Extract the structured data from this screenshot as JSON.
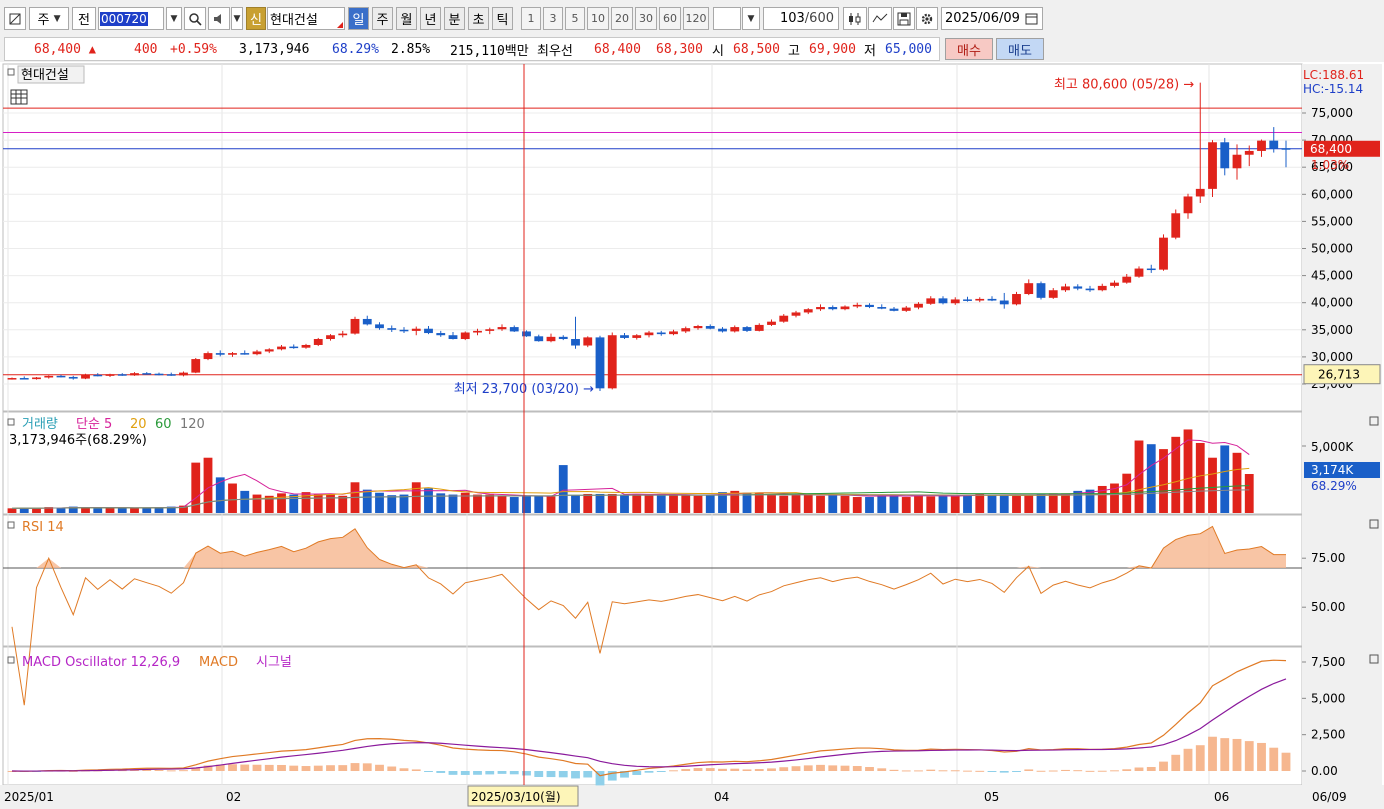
{
  "toolbar": {
    "code": "000720",
    "market": "주",
    "period_prefix": "전",
    "new_badge": "신",
    "stock_name": "현대건설",
    "period_tabs": [
      "일",
      "주",
      "월",
      "년",
      "분",
      "초",
      "틱"
    ],
    "active_period": "일",
    "intervals": [
      "1",
      "3",
      "5",
      "10",
      "20",
      "30",
      "60",
      "120"
    ],
    "count": "103",
    "count_total": "/600",
    "date": "2025/06/09"
  },
  "quote": {
    "price": "68,400",
    "up_arrow": "▲",
    "change": "400",
    "change_pct": "+0.59%",
    "volume": "3,173,946",
    "volume_ratio": "68.29%",
    "turnover_pct": "2.85%",
    "amount": "215,110백만",
    "best_label": "최우선",
    "ask": "68,400",
    "bid": "68,300",
    "open_label": "시",
    "open": "68,500",
    "high_label": "고",
    "high": "69,900",
    "low_label": "저",
    "low": "65,000",
    "buy_label": "매수",
    "sell_label": "매도"
  },
  "price_pane": {
    "stock_label": "현대건설",
    "lc": "LC:188.61",
    "hc": "HC:-15.14",
    "high_annotation": "최고 80,600 (05/28) →",
    "low_annotation": "최저 23,700 (03/20) →",
    "axis_ticks": [
      "75,000",
      "70,000",
      "65,000",
      "60,000",
      "55,000",
      "50,000",
      "45,000",
      "40,000",
      "35,000",
      "30,000",
      "25,000"
    ],
    "current_price_tag": "68,400",
    "current_pct": "1.03%",
    "crosshair_price_tag": "26,713",
    "colors": {
      "up": "#e0231b",
      "down": "#1a5fc8"
    }
  },
  "volume_pane": {
    "title": "거래량",
    "ma_label": "단순 5",
    "ma_periods": [
      "20",
      "60",
      "120"
    ],
    "info": "3,173,946주(68.29%)",
    "axis_tick": "5,000K",
    "tag": "3,174K",
    "tag_pct": "68.29%"
  },
  "rsi_pane": {
    "title": "RSI 14",
    "axis_ticks": [
      "75.00",
      "50.00"
    ]
  },
  "macd_pane": {
    "title": "MACD Oscillator 12,26,9",
    "macd_label": "MACD",
    "signal_label": "시그널",
    "axis_ticks": [
      "7,500",
      "5,000",
      "2,500",
      "0.00"
    ]
  },
  "x_axis": {
    "labels": [
      "2025/01",
      "02",
      "04",
      "05",
      "06",
      "06/09"
    ],
    "crosshair_date": "2025/03/10(월)"
  },
  "chart_data": {
    "type": "candlestick",
    "y_range": [
      22000,
      82000
    ],
    "candles": [
      [
        26000,
        26200,
        25800,
        26100
      ],
      [
        26100,
        26400,
        25900,
        25900
      ],
      [
        25900,
        26300,
        25800,
        26200
      ],
      [
        26200,
        26600,
        26000,
        26500
      ],
      [
        26500,
        26700,
        26200,
        26300
      ],
      [
        26300,
        26500,
        25800,
        26000
      ],
      [
        26000,
        26900,
        25900,
        26700
      ],
      [
        26700,
        27000,
        26400,
        26500
      ],
      [
        26500,
        26900,
        26300,
        26800
      ],
      [
        26800,
        27000,
        26500,
        26600
      ],
      [
        26600,
        27200,
        26500,
        27000
      ],
      [
        27000,
        27200,
        26700,
        26900
      ],
      [
        26900,
        27100,
        26600,
        26800
      ],
      [
        26800,
        27100,
        26500,
        26600
      ],
      [
        26600,
        27300,
        26400,
        27100
      ],
      [
        27100,
        29800,
        27000,
        29600
      ],
      [
        29600,
        31000,
        29400,
        30700
      ],
      [
        30700,
        31200,
        30100,
        30400
      ],
      [
        30400,
        30900,
        30000,
        30700
      ],
      [
        30700,
        31200,
        30400,
        30500
      ],
      [
        30500,
        31300,
        30300,
        31000
      ],
      [
        31000,
        31600,
        30700,
        31400
      ],
      [
        31400,
        32200,
        31200,
        31900
      ],
      [
        31900,
        32300,
        31500,
        31700
      ],
      [
        31700,
        32400,
        31500,
        32200
      ],
      [
        32200,
        33500,
        32000,
        33300
      ],
      [
        33300,
        34200,
        33000,
        34000
      ],
      [
        34000,
        34800,
        33600,
        34300
      ],
      [
        34300,
        37400,
        34100,
        37000
      ],
      [
        37000,
        37600,
        35800,
        36000
      ],
      [
        36000,
        36400,
        35000,
        35300
      ],
      [
        35300,
        35800,
        34600,
        35000
      ],
      [
        35000,
        35500,
        34400,
        34800
      ],
      [
        34800,
        35600,
        34000,
        35200
      ],
      [
        35200,
        35700,
        34200,
        34400
      ],
      [
        34400,
        34800,
        33700,
        34000
      ],
      [
        34000,
        34600,
        33200,
        33300
      ],
      [
        33300,
        34700,
        33100,
        34500
      ],
      [
        34500,
        35200,
        34000,
        34800
      ],
      [
        34800,
        35400,
        34200,
        35100
      ],
      [
        35100,
        36000,
        34800,
        35500
      ],
      [
        35500,
        35800,
        34600,
        34700
      ],
      [
        34700,
        34900,
        33700,
        33800
      ],
      [
        33800,
        34100,
        32800,
        32900
      ],
      [
        32900,
        34300,
        32700,
        33700
      ],
      [
        33700,
        34000,
        33100,
        33300
      ],
      [
        33300,
        37400,
        31500,
        32100
      ],
      [
        32100,
        33800,
        31800,
        33600
      ],
      [
        33600,
        33900,
        23700,
        24200
      ],
      [
        24200,
        34500,
        24000,
        34000
      ],
      [
        34000,
        34400,
        33300,
        33500
      ],
      [
        33500,
        34200,
        33200,
        34000
      ],
      [
        34000,
        34800,
        33600,
        34500
      ],
      [
        34500,
        34800,
        33900,
        34200
      ],
      [
        34200,
        35000,
        34000,
        34700
      ],
      [
        34700,
        35600,
        34400,
        35300
      ],
      [
        35300,
        35900,
        35000,
        35700
      ],
      [
        35700,
        36000,
        35100,
        35200
      ],
      [
        35200,
        35500,
        34500,
        34700
      ],
      [
        34700,
        35800,
        34500,
        35500
      ],
      [
        35500,
        35700,
        34600,
        34800
      ],
      [
        34800,
        36200,
        34700,
        35900
      ],
      [
        35900,
        36900,
        35700,
        36500
      ],
      [
        36500,
        37900,
        36300,
        37600
      ],
      [
        37600,
        38500,
        37300,
        38200
      ],
      [
        38200,
        39000,
        37900,
        38800
      ],
      [
        38800,
        39700,
        38500,
        39200
      ],
      [
        39200,
        39500,
        38600,
        38800
      ],
      [
        38800,
        39500,
        38600,
        39300
      ],
      [
        39300,
        40000,
        39000,
        39600
      ],
      [
        39600,
        39900,
        39000,
        39200
      ],
      [
        39200,
        39700,
        38800,
        38900
      ],
      [
        38900,
        39200,
        38400,
        38500
      ],
      [
        38500,
        39400,
        38300,
        39100
      ],
      [
        39100,
        40100,
        38800,
        39800
      ],
      [
        39800,
        41200,
        39600,
        40800
      ],
      [
        40800,
        41200,
        39700,
        39900
      ],
      [
        39900,
        41000,
        39600,
        40600
      ],
      [
        40600,
        41100,
        40200,
        40400
      ],
      [
        40400,
        41000,
        40100,
        40700
      ],
      [
        40700,
        41200,
        40300,
        40400
      ],
      [
        40400,
        41800,
        38900,
        39700
      ],
      [
        39700,
        42000,
        39500,
        41600
      ],
      [
        41600,
        44300,
        41400,
        43600
      ],
      [
        43600,
        43900,
        40600,
        40900
      ],
      [
        40900,
        42700,
        40700,
        42300
      ],
      [
        42300,
        43500,
        42000,
        43000
      ],
      [
        43000,
        43400,
        42300,
        42600
      ],
      [
        42600,
        43100,
        42000,
        42300
      ],
      [
        42300,
        43500,
        42100,
        43100
      ],
      [
        43100,
        44100,
        42800,
        43700
      ],
      [
        43700,
        45300,
        43500,
        44800
      ],
      [
        44800,
        46700,
        44600,
        46300
      ],
      [
        46300,
        47000,
        45500,
        46100
      ],
      [
        46100,
        52600,
        45900,
        52000
      ],
      [
        52000,
        57200,
        51700,
        56500
      ],
      [
        56500,
        60100,
        55500,
        59600
      ],
      [
        59600,
        80600,
        58400,
        61000
      ],
      [
        61000,
        70000,
        59500,
        69600
      ],
      [
        69600,
        70400,
        63500,
        64800
      ],
      [
        64800,
        69200,
        62700,
        67300
      ],
      [
        67300,
        69000,
        65200,
        68000
      ],
      [
        68000,
        70100,
        66900,
        69900
      ],
      [
        69900,
        72400,
        67700,
        68400
      ],
      [
        68500,
        69900,
        65000,
        68400
      ]
    ],
    "volumes": [
      380,
      420,
      360,
      480,
      400,
      520,
      460,
      380,
      410,
      440,
      390,
      430,
      470,
      520,
      600,
      4100,
      4500,
      2900,
      2400,
      1800,
      1500,
      1400,
      1600,
      1500,
      1700,
      1550,
      1500,
      1400,
      2500,
      1900,
      1650,
      1450,
      1500,
      2500,
      2000,
      1600,
      1500,
      1650,
      1500,
      1500,
      1400,
      1300,
      1350,
      1350,
      1350,
      3900,
      1450,
      1550,
      1550,
      1550,
      1500,
      1550,
      1450,
      1550,
      1500,
      1450,
      1400,
      1500,
      1700,
      1800,
      1650,
      1600,
      1500,
      1400,
      1550,
      1500,
      1400,
      1450,
      1400,
      1300,
      1300,
      1450,
      1500,
      1300,
      1400,
      1350,
      1400,
      1400,
      1500,
      1550,
      1500,
      1450,
      1400,
      1500,
      1550,
      1600,
      1600,
      1800,
      1900,
      2200,
      2400,
      3200,
      5900,
      5600,
      5200,
      6200,
      6800,
      5700,
      4500,
      5500,
      4900,
      3174
    ]
  }
}
